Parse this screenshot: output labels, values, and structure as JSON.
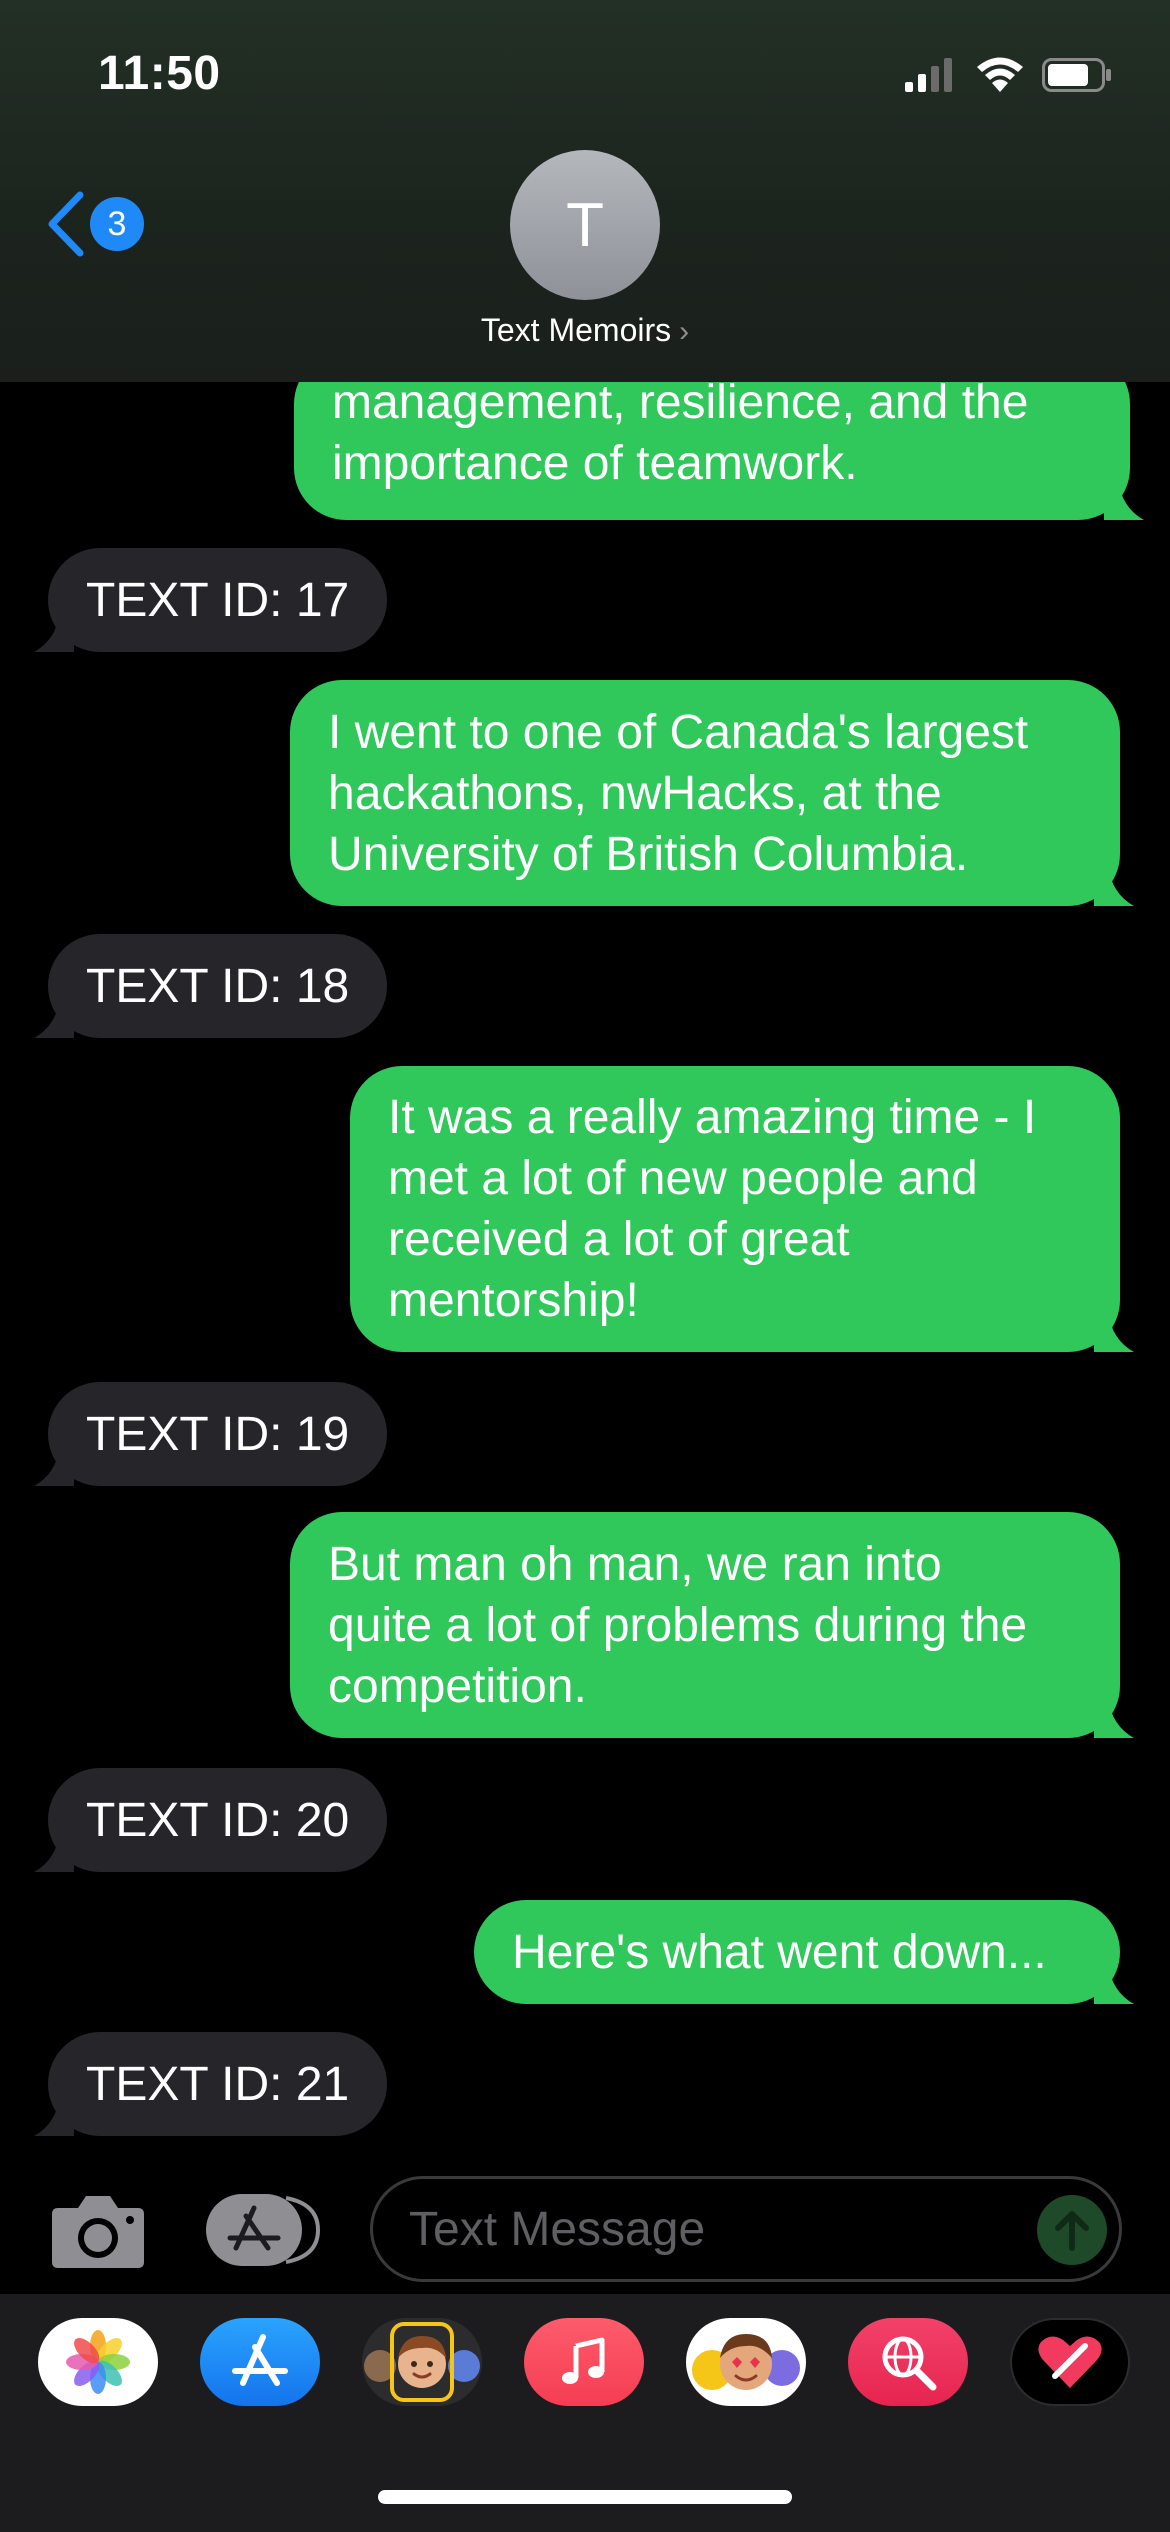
{
  "status_bar": {
    "time": "11:50"
  },
  "header": {
    "back_count": "3",
    "avatar_initial": "T",
    "contact_name": "Text Memoirs"
  },
  "messages": [
    {
      "type": "sent",
      "lines": [
        "management, resilience, and the",
        "importance of teamwork."
      ]
    },
    {
      "type": "received",
      "text": "TEXT ID: 17"
    },
    {
      "type": "sent",
      "lines": [
        "I went to one of Canada's largest",
        "hackathons, nwHacks, at the",
        "University of British Columbia."
      ]
    },
    {
      "type": "received",
      "text": "TEXT ID: 18"
    },
    {
      "type": "sent",
      "lines": [
        "It was a really amazing time - I",
        "met a lot of new people and",
        "received a lot of great",
        "mentorship!"
      ]
    },
    {
      "type": "received",
      "text": "TEXT ID: 19"
    },
    {
      "type": "sent",
      "lines": [
        "But man oh man, we ran into",
        "quite a lot of problems during the",
        "competition."
      ]
    },
    {
      "type": "received",
      "text": "TEXT ID: 20"
    },
    {
      "type": "sent",
      "lines": [
        "Here's what went down..."
      ]
    },
    {
      "type": "received",
      "text": "TEXT ID: 21"
    }
  ],
  "composer": {
    "placeholder": "Text Message"
  },
  "app_drawer": [
    {
      "name": "photos-app-icon",
      "bg": "#ffffff"
    },
    {
      "name": "appstore-app-icon",
      "bg": "#1a8cf5"
    },
    {
      "name": "memoji-app-icon",
      "bg": "#2c2c2e"
    },
    {
      "name": "music-app-icon",
      "bg": "#fa3c52"
    },
    {
      "name": "animoji-stickers-app-icon",
      "bg": "#ffffff"
    },
    {
      "name": "web-search-app-icon",
      "bg": "#ec2f5c"
    },
    {
      "name": "digital-touch-app-icon",
      "bg": "#000000"
    }
  ],
  "colors": {
    "sent_bubble": "#30c75b",
    "received_bubble": "#26252a",
    "accent": "#1f8af7"
  }
}
